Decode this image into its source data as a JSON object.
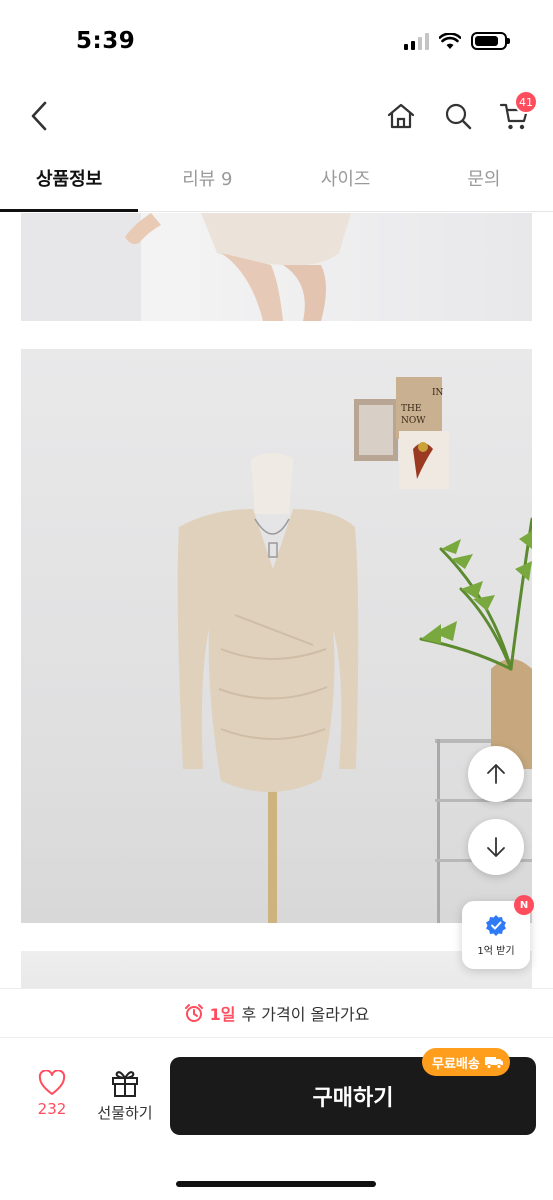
{
  "status_bar": {
    "time": "5:39"
  },
  "header": {
    "back_icon": "chevron-left-icon",
    "icons": [
      "home-icon",
      "search-icon",
      "cart-icon"
    ],
    "cart_count": "41"
  },
  "tabs": [
    {
      "label": "상품정보",
      "active": true
    },
    {
      "label": "리뷰 9",
      "active": false
    },
    {
      "label": "사이즈",
      "active": false
    },
    {
      "label": "문의",
      "active": false
    }
  ],
  "product_photo": {
    "wall_card_text": [
      "IN",
      "THE",
      "NOW"
    ]
  },
  "floating": {
    "scroll_up_icon": "arrow-up-icon",
    "scroll_down_icon": "arrow-down-icon",
    "reward_label": "1억 받기",
    "reward_badge": "N"
  },
  "notice": {
    "day": "1일",
    "text": "후 가격이 올라가요"
  },
  "actions": {
    "like_count": "232",
    "gift_label": "선물하기",
    "buy_label": "구매하기",
    "shipping_badge": "무료배송"
  },
  "colors": {
    "accent": "#ff4d5e",
    "shipping": "#ff9d1c",
    "buy_button": "#1a1a1a"
  }
}
